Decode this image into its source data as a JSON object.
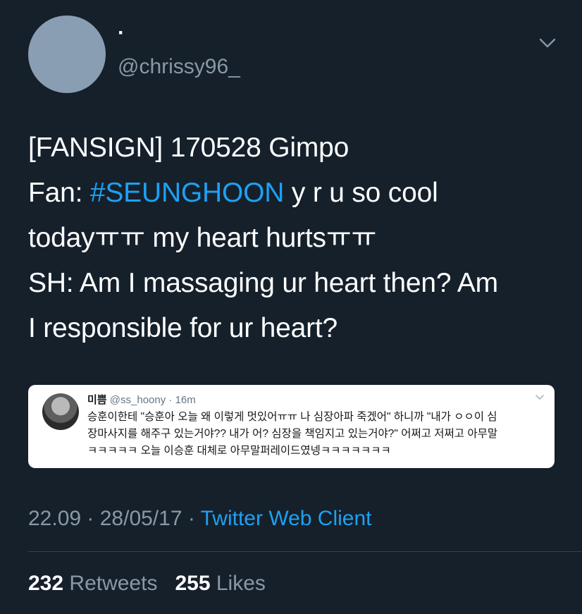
{
  "author": {
    "display_name": "·",
    "handle": "@chrissy96_",
    "avatar_color": "#8a9eb3"
  },
  "tweet": {
    "line1": "[FANSIGN] 170528 Gimpo",
    "line2_prefix": "Fan: ",
    "hashtag": "#SEUNGHOON",
    "line2_suffix": " y r u so cool",
    "line3": "todayㅠㅠ my heart hurtsㅠㅠ",
    "line4": "SH: Am I massaging ur heart then? Am",
    "line5": "I responsible for ur heart?"
  },
  "quote": {
    "name": "미쁨",
    "handle": "@ss_hoony",
    "time": "· 16m",
    "line1": "승훈이한테 \"승훈아 오늘 왜 이렇게 멋있어ㅠㅠ 나 심장아파 죽겠어\" 하니까 \"내가 ㅇㅇ이 심",
    "line2": "장마사지를 해주구 있는거야?? 내가 어? 심장을 책임지고 있는거야?\" 어쩌고 저쩌고 아무말",
    "line3": "ㅋㅋㅋㅋㅋ 오늘 이승훈 대체로 아무말퍼레이드였넹ㅋㅋㅋㅋㅋㅋㅋ"
  },
  "meta": {
    "time": "22.09 · 28/05/17 · ",
    "source": "Twitter Web Client"
  },
  "stats": {
    "retweets_count": "232",
    "retweets_label": " Retweets",
    "likes_count": "255",
    "likes_label": " Likes"
  },
  "colors": {
    "background": "#15202b",
    "accent": "#1da1f2",
    "muted": "#8899a6"
  }
}
